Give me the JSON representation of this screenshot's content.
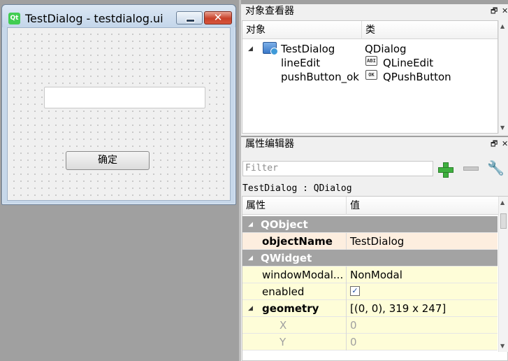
{
  "form_window": {
    "title": "TestDialog - testdialog.ui",
    "logo_text": "Qt",
    "close_glyph": "✕",
    "ok_button_label": "确定",
    "line_edit_value": ""
  },
  "object_inspector": {
    "title": "对象查看器",
    "float_glyph": "🗗",
    "close_glyph": "✕",
    "columns": [
      "对象",
      "类"
    ],
    "rows": [
      {
        "object": "TestDialog",
        "class": "QDialog",
        "icon": "dialog-icon",
        "expanded": true
      },
      {
        "object": "lineEdit",
        "class": "QLineEdit",
        "icon": "lineedit-icon",
        "icon_text": "ABI"
      },
      {
        "object": "pushButton_ok",
        "class": "QPushButton",
        "icon": "pushbutton-icon",
        "icon_text": "OK"
      }
    ]
  },
  "property_editor": {
    "title": "属性编辑器",
    "float_glyph": "🗗",
    "close_glyph": "✕",
    "filter_placeholder": "Filter",
    "tool_glyph": "🔧",
    "selection": "TestDialog : QDialog",
    "columns": [
      "属性",
      "值"
    ],
    "rows": [
      {
        "name": "QObject",
        "value": "",
        "kind": "group"
      },
      {
        "name": "objectName",
        "value": "TestDialog",
        "kind": "prop-bold"
      },
      {
        "name": "QWidget",
        "value": "",
        "kind": "group"
      },
      {
        "name": "windowModal...",
        "value": "NonModal",
        "kind": "prop"
      },
      {
        "name": "enabled",
        "value": "✓",
        "kind": "checkbox"
      },
      {
        "name": "geometry",
        "value": "[(0, 0), 319 x 247]",
        "kind": "prop-bold"
      },
      {
        "name": "X",
        "value": "0",
        "kind": "sub"
      },
      {
        "name": "Y",
        "value": "0",
        "kind": "sub"
      }
    ]
  },
  "colors": {
    "group_row_bg": "#a3a3a3",
    "highlight_row_bg": "#fdeedf",
    "property_row_bg": "#fefdd8"
  }
}
